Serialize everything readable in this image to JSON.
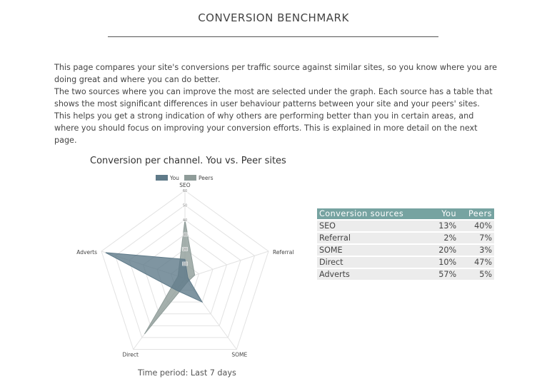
{
  "page_title": "CONVERSION BENCHMARK",
  "intro": [
    "This page compares your site's conversions per traffic source against similar sites, so you know where you are doing great and where you can do better.",
    "The two sources where you can improve the most are selected under the graph. Each source has a table that shows the most significant differences in user behaviour patterns between your site and your peers' sites. This helps you get a strong indication of why others are performing better than you in certain areas, and where you should focus on improving your conversion efforts. This is explained in more detail on the next page."
  ],
  "chart_data": {
    "type": "radar",
    "title": "Conversion per channel. You vs. Peer sites",
    "categories": [
      "SEO",
      "Referral",
      "SOME",
      "Direct",
      "Adverts"
    ],
    "series": [
      {
        "name": "You",
        "values": [
          13,
          2,
          20,
          10,
          57
        ],
        "color": "#5f7a89"
      },
      {
        "name": "Peers",
        "values": [
          40,
          7,
          3,
          47,
          5
        ],
        "color": "#8f9c99"
      }
    ],
    "ticks": [
      10,
      20,
      30,
      40,
      50,
      60
    ],
    "range": [
      0,
      60
    ],
    "legend": "top",
    "grid": true
  },
  "time_period": "Time period: Last 7 days",
  "table": {
    "headers": [
      "Conversion sources",
      "You",
      "Peers"
    ],
    "rows": [
      [
        "SEO",
        "13%",
        "40%"
      ],
      [
        "Referral",
        "2%",
        "7%"
      ],
      [
        "SOME",
        "20%",
        "3%"
      ],
      [
        "Direct",
        "10%",
        "47%"
      ],
      [
        "Adverts",
        "57%",
        "5%"
      ]
    ]
  }
}
